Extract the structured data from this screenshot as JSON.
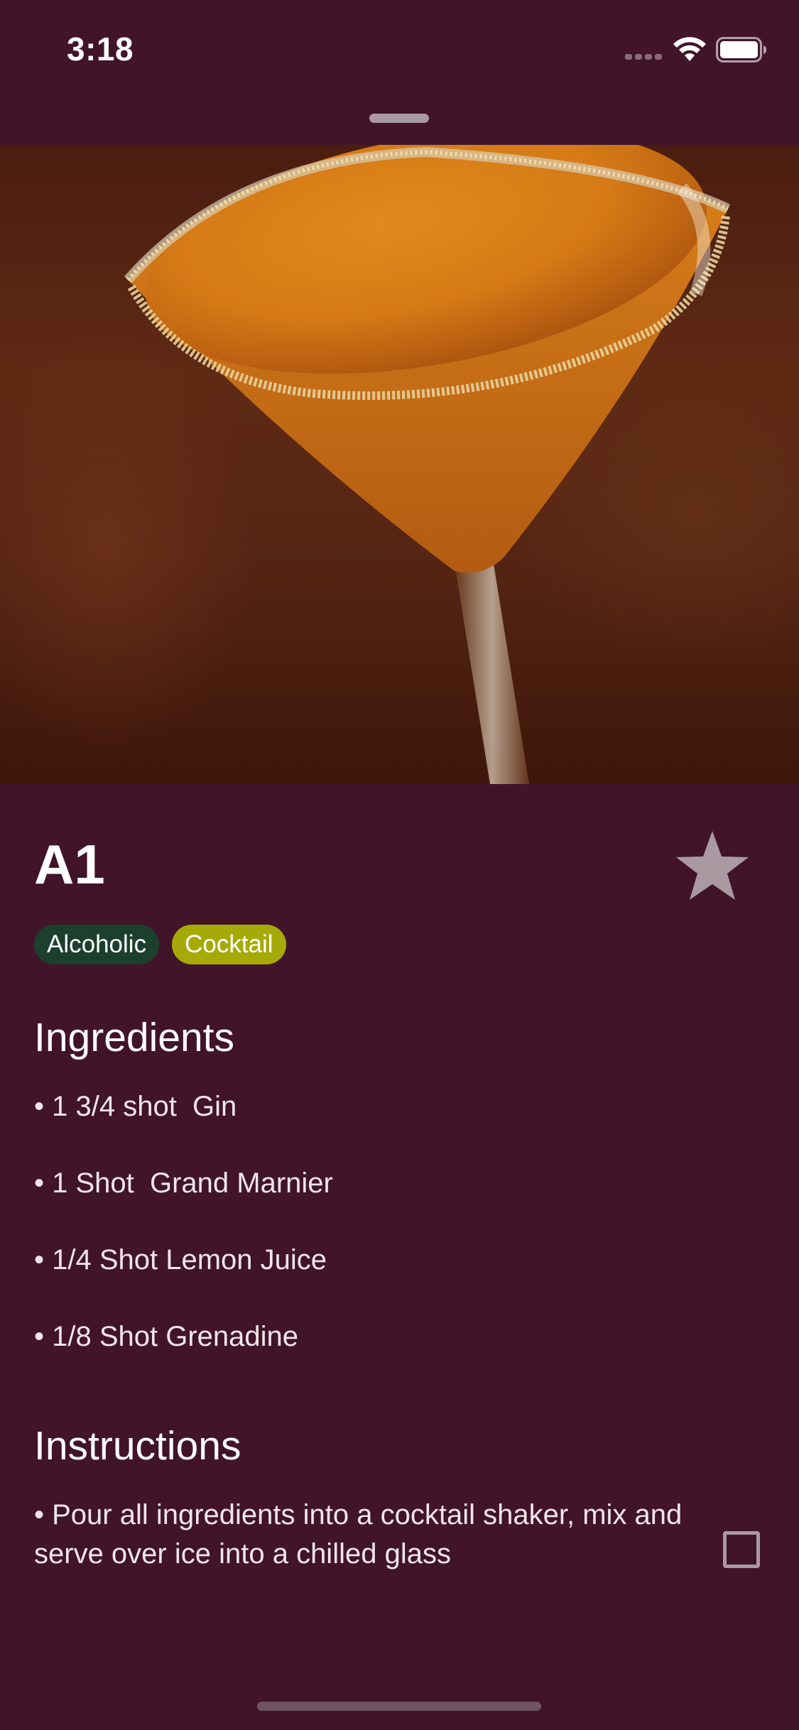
{
  "status_bar": {
    "time": "3:18",
    "signal_icon": "cellular-signal-icon",
    "wifi_icon": "wifi-icon",
    "battery_icon": "battery-full-icon"
  },
  "drink": {
    "name": "A1",
    "is_favorite": false,
    "favorite_icon": "star-icon",
    "tags": [
      {
        "label": "Alcoholic",
        "color": "#1c3f2e"
      },
      {
        "label": "Cocktail",
        "color": "#a6aa08"
      }
    ],
    "photo_description_icon": "cocktail-photo"
  },
  "ingredients": {
    "heading": "Ingredients",
    "items": [
      "• 1 3/4 shot  Gin",
      "• 1 Shot  Grand Marnier",
      "• 1/4 Shot Lemon Juice",
      "• 1/8 Shot Grenadine"
    ]
  },
  "instructions": {
    "heading": "Instructions",
    "text": "• Pour all ingredients into a cocktail shaker, mix and serve over ice into a chilled glass",
    "checked": false
  },
  "colors": {
    "background": "#41142a",
    "icon_muted": "#a99aa1"
  }
}
